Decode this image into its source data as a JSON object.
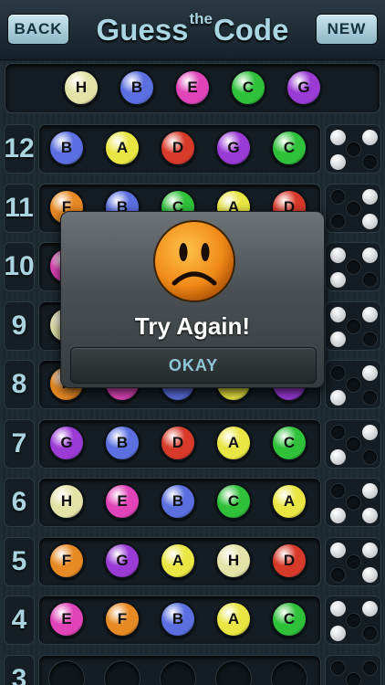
{
  "header": {
    "back_label": "BACK",
    "new_label": "NEW",
    "title_part1": "Guess",
    "title_part2": "the",
    "title_part3": "Code"
  },
  "colors": {
    "A": "#e9e542",
    "B": "#5b6fe0",
    "C": "#2fc13a",
    "D": "#d83a2a",
    "E": "#e044b8",
    "F": "#e88a24",
    "G": "#9a3bd6",
    "H": "#e3e3a8"
  },
  "secret": [
    "H",
    "B",
    "E",
    "C",
    "G"
  ],
  "rows": [
    {
      "number": "12",
      "pegs": [
        "B",
        "A",
        "D",
        "G",
        "C"
      ],
      "feedback": [
        "white",
        "white",
        "white",
        "empty"
      ]
    },
    {
      "number": "11",
      "pegs": [
        "F",
        "B",
        "C",
        "A",
        "D"
      ],
      "feedback": [
        "empty",
        "white",
        "empty",
        "white"
      ]
    },
    {
      "number": "10",
      "pegs": [
        "E",
        "",
        "",
        "",
        ""
      ],
      "feedback": [
        "white",
        "white",
        "white",
        "empty"
      ]
    },
    {
      "number": "9",
      "pegs": [
        "H",
        "",
        "",
        "",
        "A"
      ],
      "feedback": [
        "white",
        "white",
        "white",
        "empty"
      ]
    },
    {
      "number": "8",
      "pegs": [
        "F",
        "E",
        "B",
        "A",
        "G"
      ],
      "feedback": [
        "empty",
        "white",
        "white",
        "empty"
      ]
    },
    {
      "number": "7",
      "pegs": [
        "G",
        "B",
        "D",
        "A",
        "C"
      ],
      "feedback": [
        "empty",
        "white",
        "white",
        "empty"
      ]
    },
    {
      "number": "6",
      "pegs": [
        "H",
        "E",
        "B",
        "C",
        "A"
      ],
      "feedback": [
        "empty",
        "white",
        "white",
        "white"
      ]
    },
    {
      "number": "5",
      "pegs": [
        "F",
        "G",
        "A",
        "H",
        "D"
      ],
      "feedback": [
        "white",
        "white",
        "empty",
        "white"
      ]
    },
    {
      "number": "4",
      "pegs": [
        "E",
        "F",
        "B",
        "A",
        "C"
      ],
      "feedback": [
        "white",
        "white",
        "white",
        "empty"
      ]
    },
    {
      "number": "3",
      "pegs": [
        "",
        "",
        "",
        "",
        ""
      ],
      "feedback": [
        "empty",
        "empty",
        "empty",
        "empty"
      ]
    }
  ],
  "dialog": {
    "title": "Try Again!",
    "okay_label": "OKAY"
  }
}
